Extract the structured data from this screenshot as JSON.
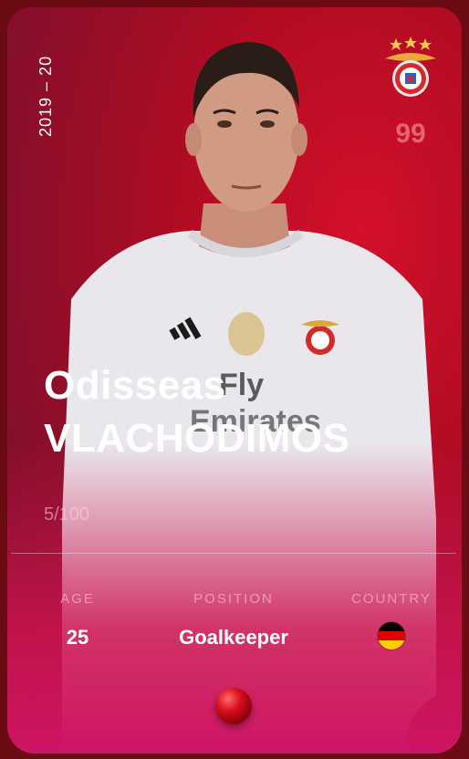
{
  "season": "2019 – 20",
  "rating": "99",
  "player": {
    "first_name": "Odisseas",
    "last_name": "VLACHODIMOS"
  },
  "serial": "5/100",
  "stats": {
    "age_label": "AGE",
    "age_value": "25",
    "position_label": "POSITION",
    "position_value": "Goalkeeper",
    "country_label": "COUNTRY"
  },
  "icons": {
    "club_crest": "benfica-crest-icon",
    "country_flag": "germany-flag-icon",
    "rarity": "red-gem-icon"
  },
  "colors": {
    "card_primary": "#b10c24",
    "card_bottom": "#cf1464",
    "frame": "#6b0b14"
  }
}
